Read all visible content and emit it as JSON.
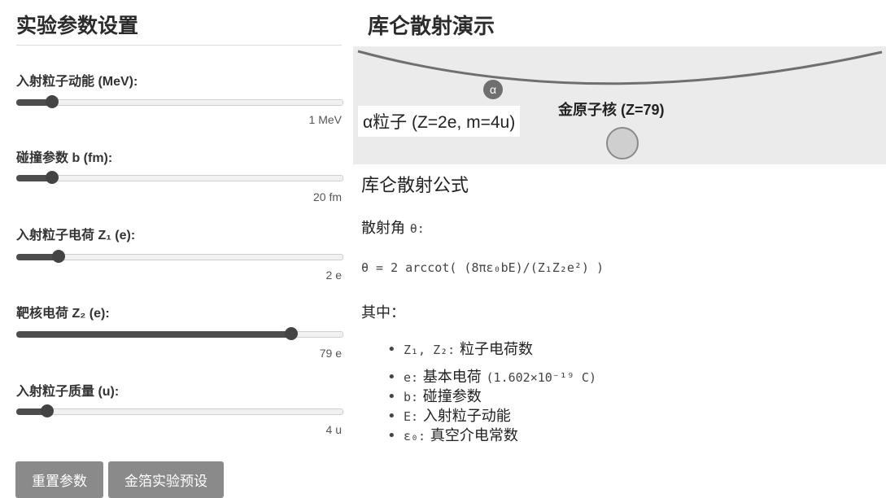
{
  "settings": {
    "title": "实验参数设置",
    "params": [
      {
        "label": "入射粒子动能 (MeV):",
        "value_text": "1 MeV",
        "fraction": 0.11
      },
      {
        "label": "碰撞参数 b (fm):",
        "value_text": "20 fm",
        "fraction": 0.11
      },
      {
        "label": "入射粒子电荷 Z₁ (e):",
        "value_text": "2 e",
        "fraction": 0.13
      },
      {
        "label": "靶核电荷 Z₂ (e):",
        "value_text": "79 e",
        "fraction": 0.84
      },
      {
        "label": "入射粒子质量 (u):",
        "value_text": "4 u",
        "fraction": 0.095
      }
    ],
    "buttons": {
      "reset": "重置参数",
      "gold_foil": "金箔实验预设"
    }
  },
  "demo": {
    "title": "库仑散射演示",
    "alpha_symbol": "α",
    "alpha_label": "α粒子 (Z=2e, m=4u)",
    "nucleus_label": "金原子核 (Z=79)"
  },
  "formula": {
    "heading": "库仑散射公式",
    "angle_intro": "散射角",
    "angle_symbol": "θ:",
    "expression": "θ = 2 arccot( (8πε₀bE)/(Z₁Z₂e²) )",
    "where": "其中：",
    "items": [
      {
        "sym": "Z₁, Z₂:",
        "desc": "粒子电荷数"
      },
      {
        "sym": "e:",
        "desc": "基本电荷",
        "extra": "(1.602×10⁻¹⁹ C)"
      },
      {
        "sym": "b:",
        "desc": "碰撞参数"
      },
      {
        "sym": "E:",
        "desc": "入射粒子动能"
      },
      {
        "sym": "ε₀:",
        "desc": "真空介电常数"
      }
    ]
  }
}
